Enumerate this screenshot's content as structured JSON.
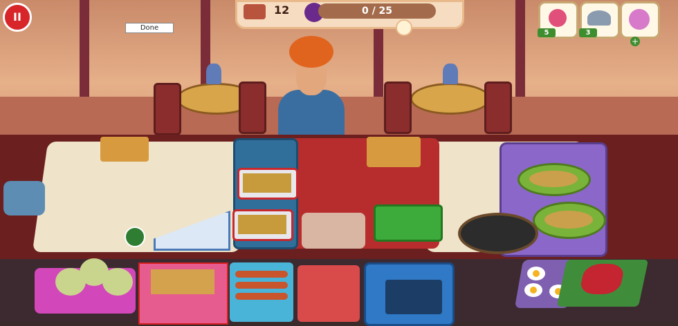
{
  "hud": {
    "pause_glyph": "II",
    "done_label": "Done",
    "customers_count": "12",
    "progress_text": "0 / 25",
    "progress_fraction": 0.0
  },
  "powerups": [
    {
      "name": "candy-booster",
      "count": "5"
    },
    {
      "name": "cloche-booster",
      "count": "3"
    },
    {
      "name": "ice-cream-booster",
      "count": "+"
    }
  ],
  "colors": {
    "pause": "#d7252a",
    "hud_panel": "#f6dcc0",
    "counter": "#6b1f1f",
    "selection": "#d61f1f"
  }
}
